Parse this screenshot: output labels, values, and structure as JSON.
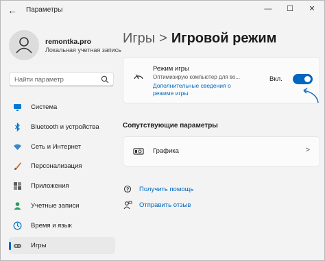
{
  "window": {
    "title": "Параметры",
    "back_glyph": "←",
    "minimize_glyph": "—",
    "maximize_glyph": "☐",
    "close_glyph": "✕"
  },
  "profile": {
    "name": "remontka.pro",
    "account_type": "Локальная учетная запись"
  },
  "search": {
    "placeholder": "Найти параметр"
  },
  "sidebar": {
    "items": [
      {
        "label": "Система",
        "icon": "monitor-icon",
        "color": "#0078d4"
      },
      {
        "label": "Bluetooth и устройства",
        "icon": "bluetooth-icon",
        "color": "#0078d4"
      },
      {
        "label": "Сеть и Интернет",
        "icon": "wifi-icon",
        "color": "#3a86c8"
      },
      {
        "label": "Персонализация",
        "icon": "brush-icon",
        "color": "#d0662d"
      },
      {
        "label": "Приложения",
        "icon": "apps-icon",
        "color": "#5a5a5a"
      },
      {
        "label": "Учетные записи",
        "icon": "person-icon",
        "color": "#2d9a5f"
      },
      {
        "label": "Время и язык",
        "icon": "globe-clock-icon",
        "color": "#0a7bc7"
      },
      {
        "label": "Игры",
        "icon": "gamepad-icon",
        "color": "#6b6b6b",
        "selected": true
      }
    ]
  },
  "breadcrumb": {
    "parent": "Игры",
    "separator": ">",
    "current": "Игровой режим"
  },
  "game_mode": {
    "title": "Режим игры",
    "description": "Оптимизирую компьютер для во...",
    "link": "Дополнительные сведения о режиме игры",
    "toggle_label": "Вкл.",
    "toggle_on": true,
    "accent": "#0067c0"
  },
  "related": {
    "title": "Сопутствующие параметры",
    "items": [
      {
        "label": "Графика",
        "chevron": ">"
      }
    ]
  },
  "help": {
    "get_help": "Получить помощь",
    "feedback": "Отправить отзыв"
  }
}
